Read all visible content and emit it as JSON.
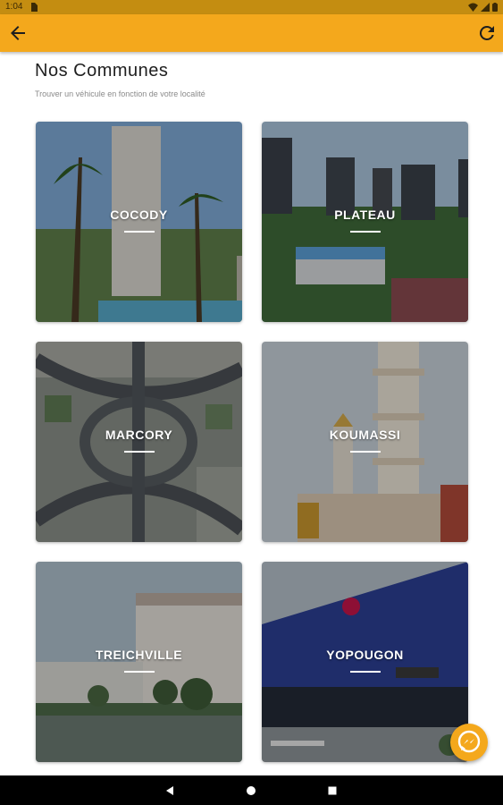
{
  "status_bar": {
    "time": "1:04",
    "icons": [
      "sim-card-icon",
      "wifi-icon",
      "signal-icon",
      "battery-icon"
    ]
  },
  "app_bar": {
    "back_icon": "arrow-left-icon",
    "refresh_icon": "refresh-icon",
    "color": "#f4a81c"
  },
  "page": {
    "title": "Nos Communes",
    "subtitle": "Trouver un véhicule en fonction de votre localité"
  },
  "communes": [
    {
      "name": "COCODY"
    },
    {
      "name": "PLATEAU"
    },
    {
      "name": "MARCORY"
    },
    {
      "name": "KOUMASSI"
    },
    {
      "name": "TREICHVILLE"
    },
    {
      "name": "YOPOUGON"
    }
  ],
  "fab": {
    "icon": "messenger-icon"
  },
  "nav_bar": {
    "icons": [
      "back-triangle-icon",
      "home-circle-icon",
      "recents-square-icon"
    ]
  }
}
